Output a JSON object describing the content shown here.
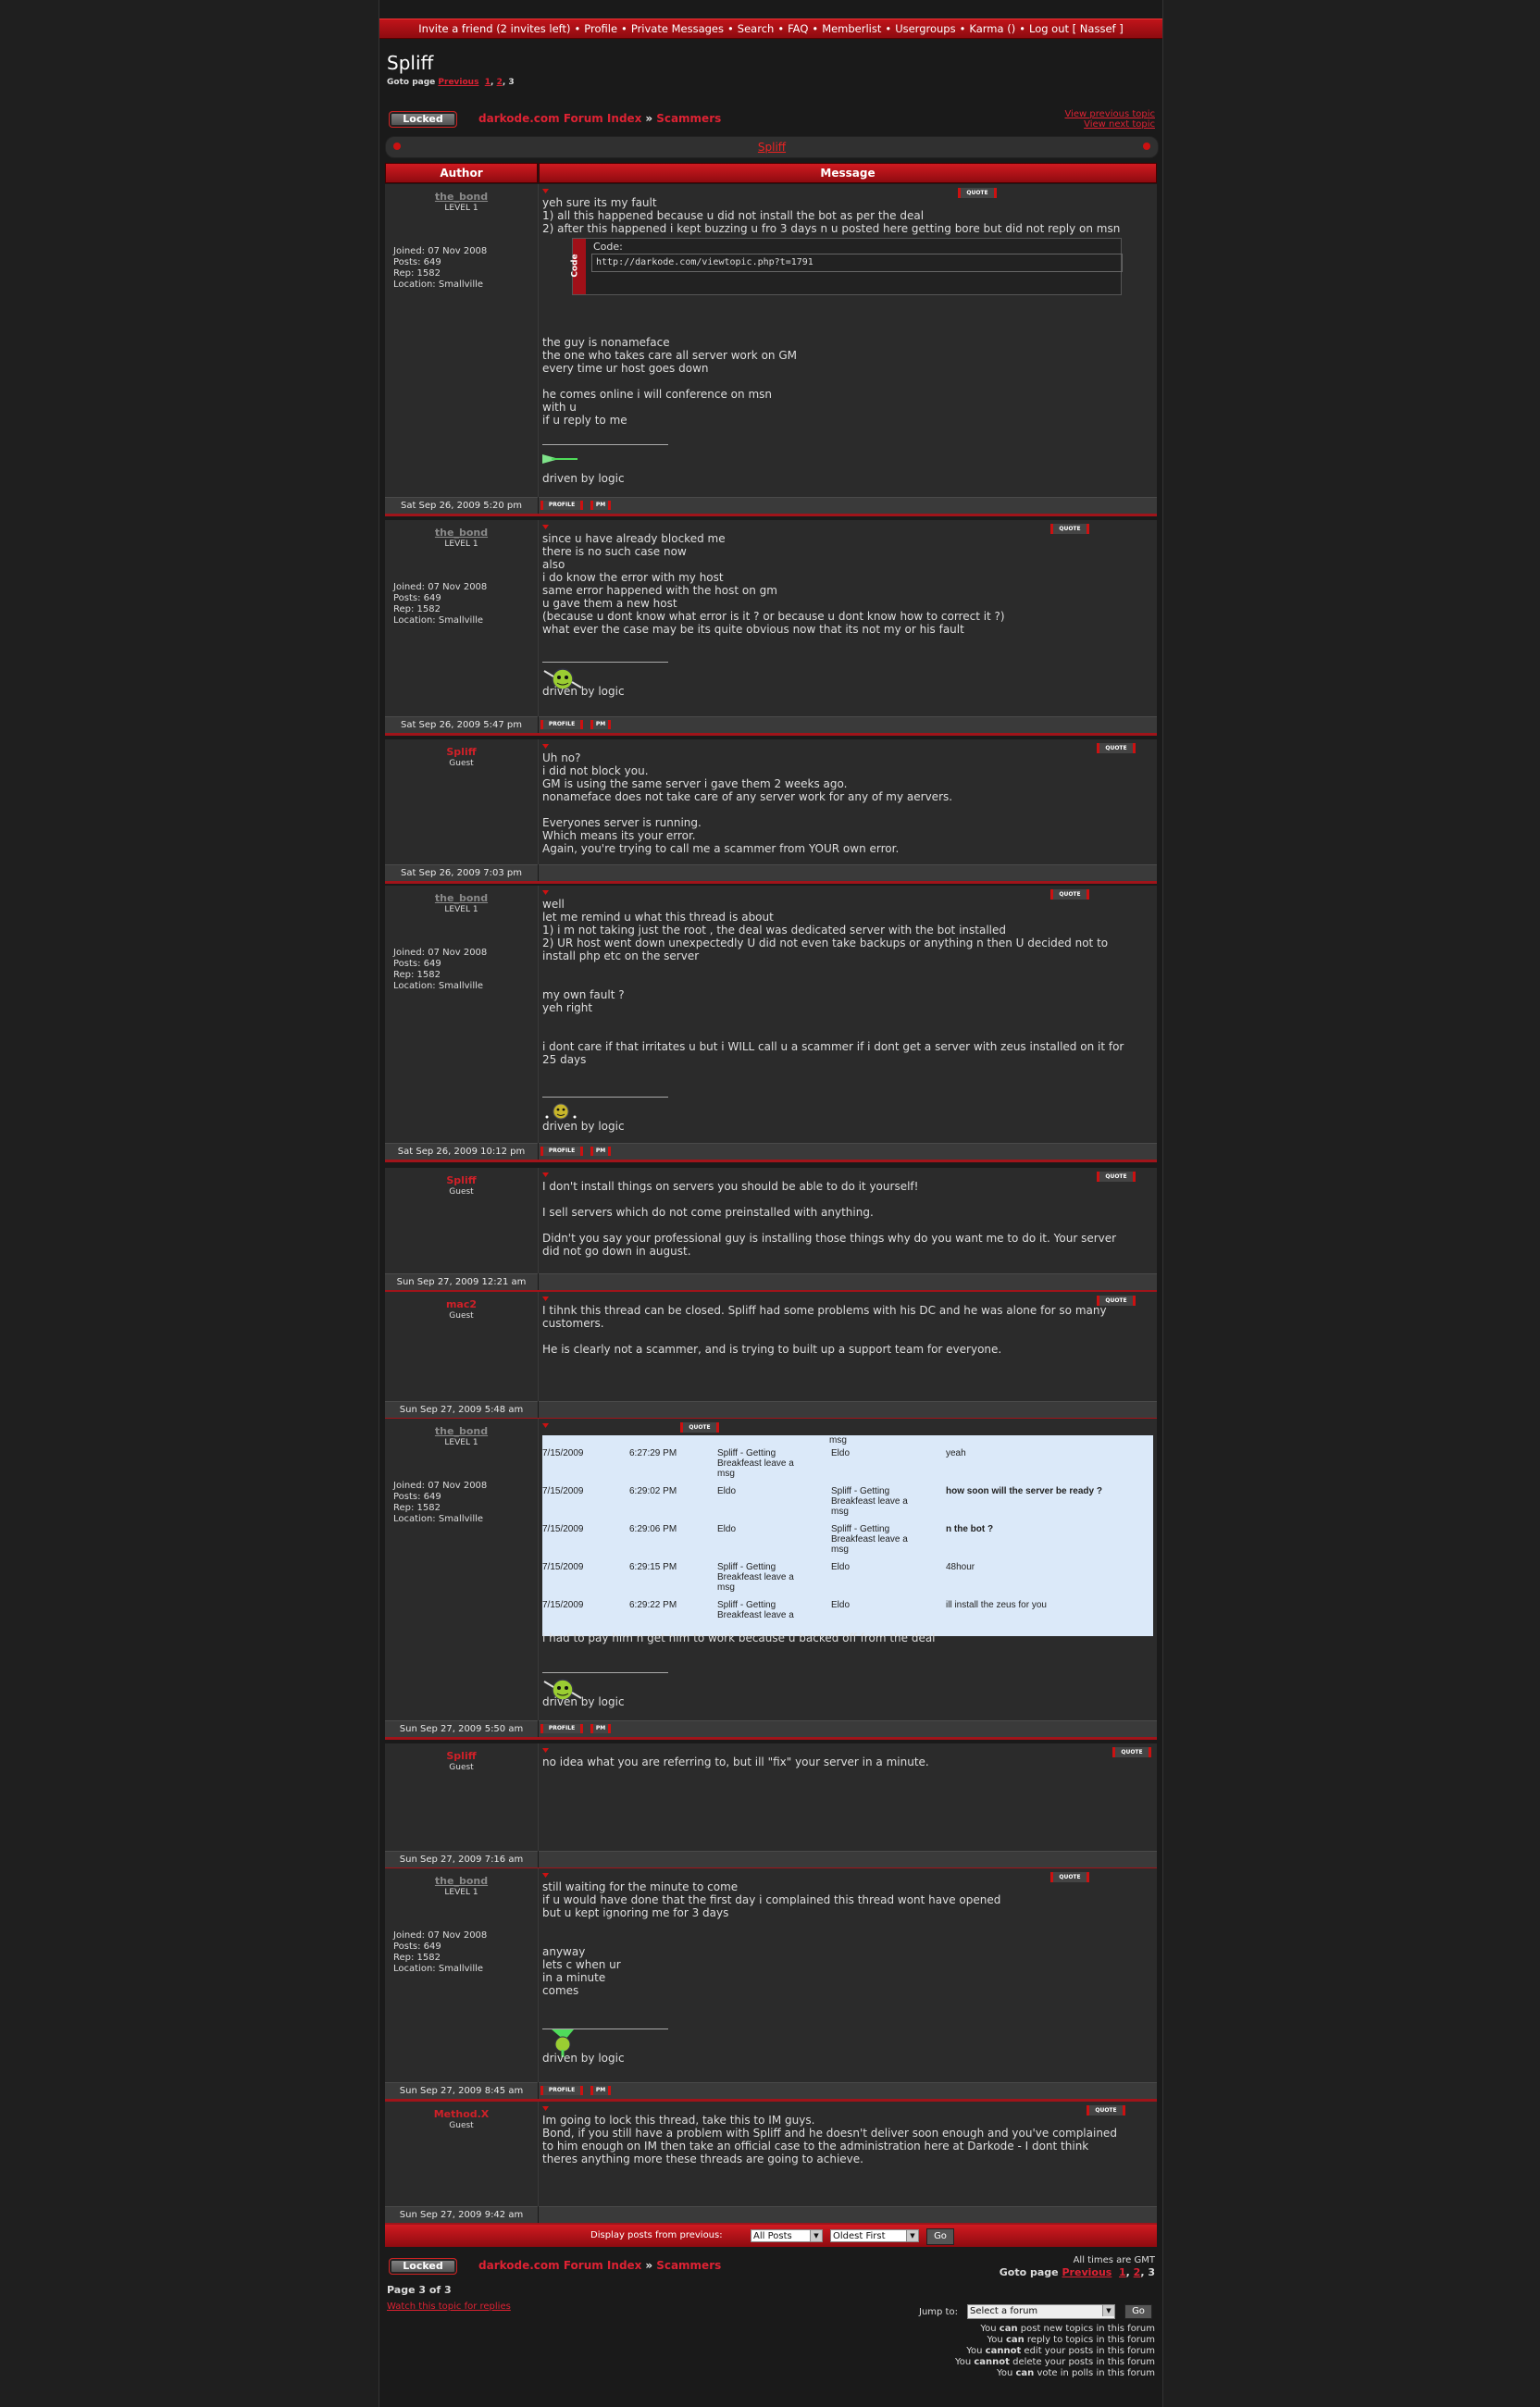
{
  "topnav": {
    "items": [
      "Invite a friend (2 invites left)",
      "Profile",
      "Private Messages",
      "Search",
      "FAQ",
      "Memberlist",
      "Usergroups",
      "Karma ()",
      "Log out [ Nassef ]"
    ],
    "separator": "•"
  },
  "topic_title": "Spliff",
  "pagination": {
    "label": "Goto page",
    "previous": "Previous",
    "pages": [
      "1",
      "2",
      "3"
    ],
    "current": "3",
    "page_of": "Page 3 of 3"
  },
  "locked_label": "Locked",
  "breadcrumb": {
    "forum_index": "darkode.com Forum Index",
    "separator": "»",
    "forum": "Scammers"
  },
  "view_links": {
    "previous": "View previous topic",
    "next": "View next topic"
  },
  "table_header": {
    "author": "Author",
    "message": "Message"
  },
  "quote_label": "QUOTE",
  "profile_label": "PROFILE",
  "pm_label": "PM",
  "signature": "driven by logic",
  "posts": [
    {
      "author": "the_bond",
      "rank": "LEVEL 1",
      "member": true,
      "info": [
        "Joined: 07 Nov 2008",
        "Posts: 649",
        "Rep: 1582",
        "Location: Smallville"
      ],
      "text_a": "yeh sure its my fault\n1) all this happened because u did not install the bot as per the deal\n2) after this happened i kept buzzing u fro 3 days n u posted here getting bore but did not reply on msn",
      "code_label": "Code:",
      "code": "http://darkode.com/viewtopic.php?t=1791",
      "text_b": "the guy is nonameface\nthe one who takes care all server work on GM\nevery time ur host goes down\n\nhe comes online i will conference on msn\nwith u\nif u reply to me",
      "date": "Sat Sep 26, 2009 5:20 pm"
    },
    {
      "author": "the_bond",
      "rank": "LEVEL 1",
      "member": true,
      "info": [
        "Joined: 07 Nov 2008",
        "Posts: 649",
        "Rep: 1582",
        "Location: Smallville"
      ],
      "text_a": "since u have already blocked me\nthere is no such case now\nalso\ni do know the error with my host\nsame error happened with the host on gm\nu gave them a new host\n(because u dont know what error is it ? or because u dont know how to correct it ?)\nwhat ever the case may be its quite obvious now that its not my or his fault",
      "date": "Sat Sep 26, 2009 5:47 pm"
    },
    {
      "author": "Spliff",
      "rank": "Guest",
      "member": false,
      "text_a": "Uh no?\ni did not block you.\nGM is using the same server i gave them 2 weeks ago.\nnonameface does not take care of any server work for any of my aervers.\n\nEveryones server is running.\nWhich means its your error.\nAgain, you're trying to call me a scammer from YOUR own error.",
      "date": "Sat Sep 26, 2009 7:03 pm"
    },
    {
      "author": "the_bond",
      "rank": "LEVEL 1",
      "member": true,
      "info": [
        "Joined: 07 Nov 2008",
        "Posts: 649",
        "Rep: 1582",
        "Location: Smallville"
      ],
      "text_a": "well\nlet me remind u what this thread is about\n1) i m not taking just the root , the deal was dedicated server with the bot installed\n2) UR host went down unexpectedly U did not even take backups or anything n then U decided not to\ninstall php etc on the server\n\n\nmy own fault ?\nyeh right\n\n\ni dont care if that irritates u but i WILL call u a scammer if i dont get a server with zeus installed on it for\n25 days",
      "date": "Sat Sep 26, 2009 10:12 pm"
    },
    {
      "author": "Spliff",
      "rank": "Guest",
      "member": false,
      "text_a": "I don't install things on servers you should be able to do it yourself!\n\nI sell servers which do not come preinstalled with anything.\n\nDidn't you say your professional guy is installing those things why do you want me to do it. Your server\ndid not go down in august.",
      "date": "Sun Sep 27, 2009 12:21 am"
    },
    {
      "author": "mac2",
      "rank": "Guest",
      "member": false,
      "text_a": "I tihnk this thread can be closed. Spliff had some problems with his DC and he was alone for so many\ncustomers.\n\nHe is clearly not a scammer, and is trying to built up a support team for everyone.",
      "date": "Sun Sep 27, 2009 5:48 am"
    },
    {
      "author": "the_bond",
      "rank": "LEVEL 1",
      "member": true,
      "info": [
        "Joined: 07 Nov 2008",
        "Posts: 649",
        "Rep: 1582",
        "Location: Smallville"
      ],
      "chat_top": "msg",
      "chat": [
        [
          "7/15/2009",
          "6:27:29 PM",
          "Spliff - Getting\nBreakfeast leave a\nmsg",
          "Eldo",
          "yeah",
          false
        ],
        [
          "7/15/2009",
          "6:29:02 PM",
          "Eldo",
          "Spliff - Getting\nBreakfeast leave a\nmsg",
          "how soon will the server be ready ?",
          true
        ],
        [
          "7/15/2009",
          "6:29:06 PM",
          "Eldo",
          "Spliff - Getting\nBreakfeast leave a\nmsg",
          "n the bot ?",
          true
        ],
        [
          "7/15/2009",
          "6:29:15 PM",
          "Spliff - Getting\nBreakfeast leave a\nmsg",
          "Eldo",
          "48hour",
          false
        ],
        [
          "7/15/2009",
          "6:29:22 PM",
          "Spliff - Getting\nBreakfeast leave a",
          "Eldo",
          "ill install the zeus for you",
          false
        ]
      ],
      "text_a": "i had to pay him n get him to work because u backed off from the deal",
      "date": "Sun Sep 27, 2009 5:50 am"
    },
    {
      "author": "Spliff",
      "rank": "Guest",
      "member": false,
      "text_a": "no idea what you are referring to, but ill \"fix\" your server in a minute.",
      "date": "Sun Sep 27, 2009 7:16 am"
    },
    {
      "author": "the_bond",
      "rank": "LEVEL 1",
      "member": true,
      "info": [
        "Joined: 07 Nov 2008",
        "Posts: 649",
        "Rep: 1582",
        "Location: Smallville"
      ],
      "text_a": "still waiting for the minute to come\nif u would have done that the first day i complained this thread wont have opened\nbut u kept ignoring me for 3 days\n\n\nanyway\nlets c when ur\nin a minute\ncomes",
      "date": "Sun Sep 27, 2009 8:45 am"
    },
    {
      "author": "Method.X",
      "rank": "Guest",
      "member": false,
      "text_a": "Im going to lock this thread, take this to IM guys.\nBond, if you still have a problem with Spliff and he doesn't deliver soon enough and you've complained\nto him enough on IM then take an official case to the administration here at Darkode - I dont think\ntheres anything more these threads are going to achieve.",
      "date": "Sun Sep 27, 2009 9:42 am"
    }
  ],
  "display_bar": {
    "label": "Display posts from previous:",
    "filter": "All Posts",
    "order": "Oldest First",
    "go": "Go"
  },
  "all_times": "All times are GMT",
  "watch_topic": "Watch this topic for replies",
  "jump": {
    "label": "Jump to:",
    "placeholder": "Select a forum",
    "go": "Go"
  },
  "permissions": [
    [
      "You ",
      "can",
      " post new topics in this forum"
    ],
    [
      "You ",
      "can",
      " reply to topics in this forum"
    ],
    [
      "You ",
      "cannot",
      " edit your posts in this forum"
    ],
    [
      "You ",
      "cannot",
      " delete your posts in this forum"
    ],
    [
      "You ",
      "can",
      " vote in polls in this forum"
    ]
  ],
  "colors": {
    "accent": "#c0141a",
    "link": "#dd2233",
    "background": "#1a1a1a",
    "panel": "#2b2b2b",
    "chat_bg": "#dbe9f9"
  }
}
